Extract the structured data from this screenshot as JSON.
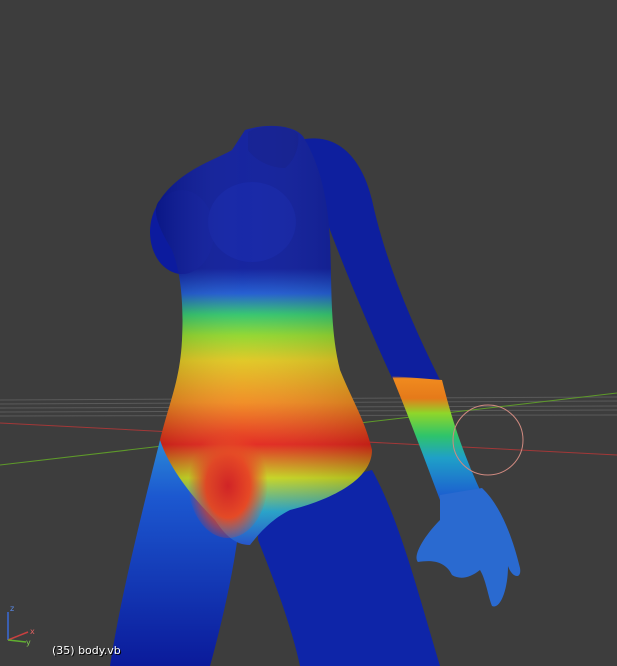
{
  "viewport": {
    "object_label": "(35) body.vb",
    "background_color": "#3d3d3d",
    "grid_color": "#5a5a5a",
    "x_axis_color": "#a33838",
    "y_axis_color": "#5e9a2a"
  },
  "mesh": {
    "name": "body.vb",
    "display_mode": "weight-paint",
    "gradient_colors": [
      "#0b1a9a",
      "#1c58d0",
      "#1fa0c8",
      "#2fc46a",
      "#d9d21a",
      "#f08a1e",
      "#e3241a"
    ]
  },
  "brush_cursor": {
    "color": "#d08a80"
  },
  "axis_gizmo": {
    "x_label": "x",
    "y_label": "y",
    "z_label": "z"
  }
}
